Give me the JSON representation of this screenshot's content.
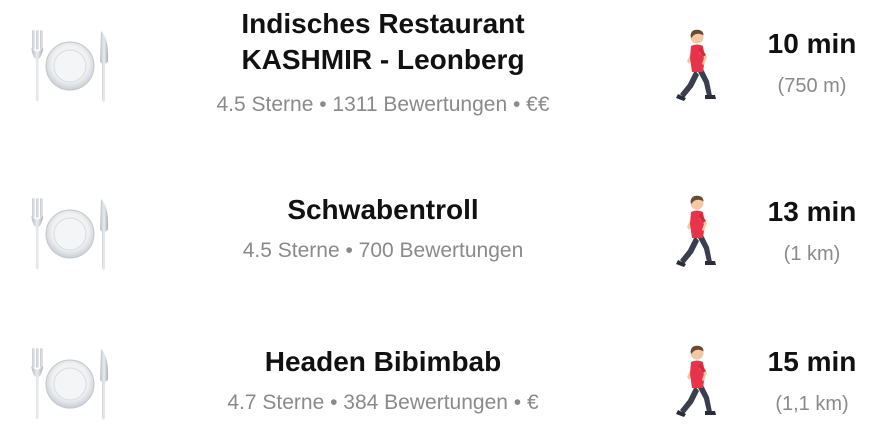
{
  "restaurants": [
    {
      "name": "Indisches Restaurant\nKASHMIR - Leonberg",
      "meta": "4.5 Sterne • 1311 Bewertungen • €€",
      "time": "10 min",
      "distance": "(750 m)",
      "place_icon": "fork-plate-knife-icon",
      "walk_icon": "person-walking-icon"
    },
    {
      "name": "Schwabentroll",
      "meta": "4.5 Sterne • 700 Bewertungen",
      "time": "13 min",
      "distance": "(1 km)",
      "place_icon": "fork-plate-knife-icon",
      "walk_icon": "person-walking-icon"
    },
    {
      "name": "Headen Bibimbab",
      "meta": "4.7 Sterne • 384 Bewertungen • €",
      "time": "15 min",
      "distance": "(1,1 km)",
      "place_icon": "fork-plate-knife-icon",
      "walk_icon": "person-walking-icon"
    }
  ],
  "colors": {
    "title": "#111111",
    "secondary": "#8a8a8a",
    "shirt": "#e8344a",
    "skin": "#f2c9a5",
    "hair": "#6b4a2e",
    "pants": "#3a3f4d"
  }
}
